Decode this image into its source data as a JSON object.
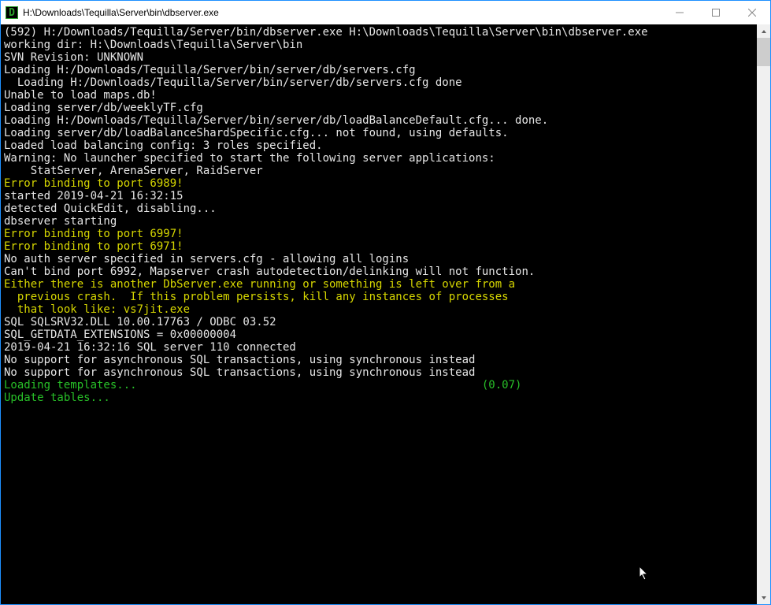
{
  "window": {
    "title": "H:\\Downloads\\Tequilla\\Server\\bin\\dbserver.exe",
    "icon_letter": "D"
  },
  "terminal": {
    "lines": [
      {
        "color": "white",
        "text": "(592) H:/Downloads/Tequilla/Server/bin/dbserver.exe H:\\Downloads\\Tequilla\\Server\\bin\\dbserver.exe"
      },
      {
        "color": "white",
        "text": "working dir: H:\\Downloads\\Tequilla\\Server\\bin"
      },
      {
        "color": "white",
        "text": "SVN Revision: UNKNOWN"
      },
      {
        "color": "white",
        "text": "Loading H:/Downloads/Tequilla/Server/bin/server/db/servers.cfg"
      },
      {
        "color": "white",
        "text": "  Loading H:/Downloads/Tequilla/Server/bin/server/db/servers.cfg done"
      },
      {
        "color": "white",
        "text": "Unable to load maps.db!"
      },
      {
        "color": "white",
        "text": "Loading server/db/weeklyTF.cfg"
      },
      {
        "color": "white",
        "text": "Loading H:/Downloads/Tequilla/Server/bin/server/db/loadBalanceDefault.cfg... done."
      },
      {
        "color": "white",
        "text": "Loading server/db/loadBalanceShardSpecific.cfg... not found, using defaults."
      },
      {
        "color": "white",
        "text": "Loaded load balancing config: 3 roles specified."
      },
      {
        "color": "white",
        "text": "Warning: No launcher specified to start the following server applications:"
      },
      {
        "color": "white",
        "text": "    StatServer, ArenaServer, RaidServer"
      },
      {
        "color": "yellow",
        "text": "Error binding to port 6989!"
      },
      {
        "color": "white",
        "text": "started 2019-04-21 16:32:15"
      },
      {
        "color": "white",
        "text": "detected QuickEdit, disabling..."
      },
      {
        "color": "white",
        "text": "dbserver starting"
      },
      {
        "color": "yellow",
        "text": "Error binding to port 6997!"
      },
      {
        "color": "yellow",
        "text": "Error binding to port 6971!"
      },
      {
        "color": "white",
        "text": "No auth server specified in servers.cfg - allowing all logins"
      },
      {
        "color": "white",
        "text": "Can't bind port 6992, Mapserver crash autodetection/delinking will not function."
      },
      {
        "color": "yellow",
        "text": "Either there is another DbServer.exe running or something is left over from a"
      },
      {
        "color": "yellow",
        "text": "  previous crash.  If this problem persists, kill any instances of processes"
      },
      {
        "color": "yellow",
        "text": "  that look like: vs7jit.exe"
      },
      {
        "color": "white",
        "text": "SQL SQLSRV32.DLL 10.00.17763 / ODBC 03.52"
      },
      {
        "color": "white",
        "text": "SQL_GETDATA_EXTENSIONS = 0x00000004"
      },
      {
        "color": "white",
        "text": "2019-04-21 16:32:16 SQL server 110 connected"
      },
      {
        "color": "white",
        "text": "No support for asynchronous SQL transactions, using synchronous instead"
      },
      {
        "color": "white",
        "text": "No support for asynchronous SQL transactions, using synchronous instead"
      }
    ],
    "loading": {
      "label": "Loading templates...                                                    ",
      "time": "(0.07)"
    },
    "final_line": {
      "color": "green",
      "text": "Update tables..."
    }
  }
}
